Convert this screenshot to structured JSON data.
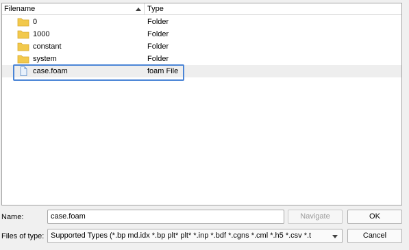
{
  "columns": {
    "filename": "Filename",
    "type": "Type"
  },
  "files": [
    {
      "name": "0",
      "type": "Folder",
      "icon": "folder-icon"
    },
    {
      "name": "1000",
      "type": "Folder",
      "icon": "folder-icon"
    },
    {
      "name": "constant",
      "type": "Folder",
      "icon": "folder-icon"
    },
    {
      "name": "system",
      "type": "Folder",
      "icon": "folder-icon"
    },
    {
      "name": "case.foam",
      "type": "foam File",
      "icon": "file-icon",
      "selected": true
    }
  ],
  "form": {
    "name_label": "Name:",
    "name_value": "case.foam",
    "filetype_label": "Files of type:",
    "filetype_value": "Supported Types (*.bp md.idx *.bp plt* plt* *.inp *.bdf *.cgns *.cml *.h5 *.csv *.t"
  },
  "buttons": {
    "navigate": "Navigate",
    "ok": "OK",
    "cancel": "Cancel"
  },
  "colors": {
    "folder": "#f2c94c",
    "highlight": "#4a84d6",
    "selected_row": "#eeeeee"
  }
}
